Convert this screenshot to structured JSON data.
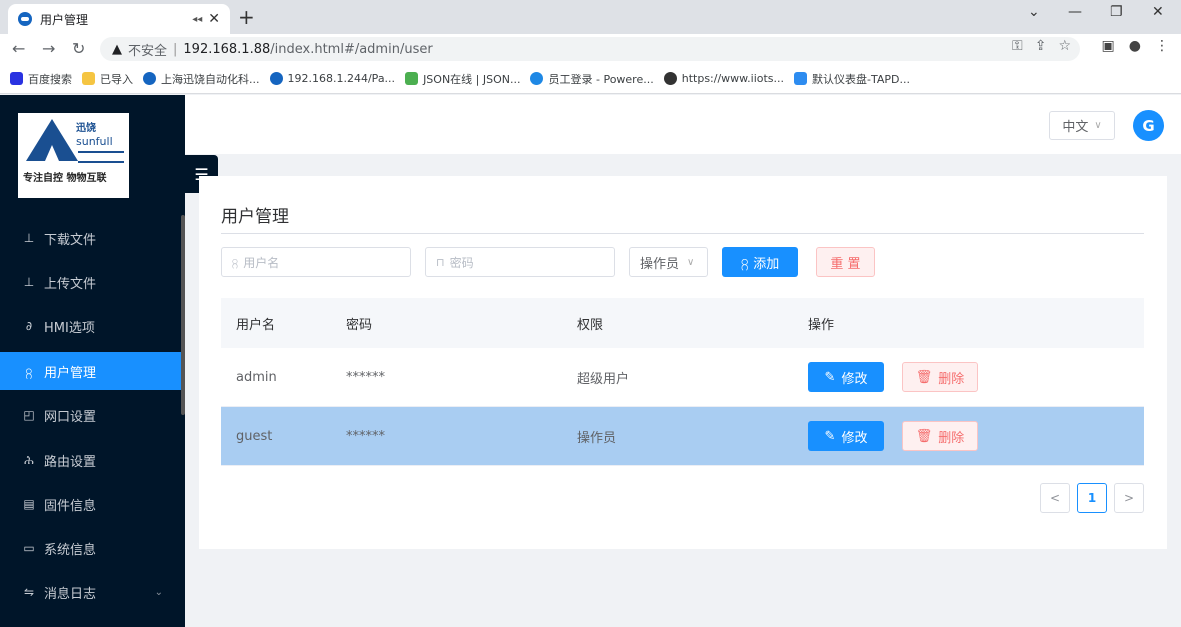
{
  "browser": {
    "tab_title": "用户管理",
    "url_warning": "▲",
    "url_insecure": "不安全",
    "url_sep": "|",
    "url_host": "192.168.1.88",
    "url_path": "/index.html#/admin/user",
    "bookmarks": [
      {
        "label": "百度搜索",
        "color": "#2932e1"
      },
      {
        "label": "已导入",
        "color": "#f5c542"
      },
      {
        "label": "上海迅饶自动化科...",
        "color": "#1565c0"
      },
      {
        "label": "192.168.1.244/Pa...",
        "color": "#1565c0"
      },
      {
        "label": "JSON在线 | JSON...",
        "color": "#4caf50"
      },
      {
        "label": "员工登录 - Powere...",
        "color": "#1e88e5"
      },
      {
        "label": "https://www.iiots...",
        "color": "#333333"
      },
      {
        "label": "默认仪表盘-TAPD...",
        "color": "#2d8cf0"
      }
    ]
  },
  "logo": {
    "brand_cn": "迅饶",
    "brand_en": "sunfull",
    "slogan": "专注自控 物物互联"
  },
  "sidebar": {
    "items": [
      {
        "label": "下载文件",
        "icon": "⊥"
      },
      {
        "label": "上传文件",
        "icon": "⊥"
      },
      {
        "label": "HMI选项",
        "icon": "∂"
      },
      {
        "label": "用户管理",
        "icon": "႙"
      },
      {
        "label": "网口设置",
        "icon": "◰"
      },
      {
        "label": "路由设置",
        "icon": "ሕ"
      },
      {
        "label": "固件信息",
        "icon": "▤"
      },
      {
        "label": "系统信息",
        "icon": "▭"
      },
      {
        "label": "消息日志",
        "icon": "⇋"
      }
    ]
  },
  "header": {
    "language": "中文",
    "avatar_letter": "G"
  },
  "page": {
    "title": "用户管理",
    "username_placeholder": "用户名",
    "password_placeholder": "密码",
    "role_select": "操作员",
    "add_label": "添加",
    "reset_label": "重 置"
  },
  "table": {
    "headers": [
      "用户名",
      "密码",
      "权限",
      "操作"
    ],
    "rows": [
      {
        "username": "admin",
        "password": "******",
        "role": "超级用户",
        "edit": "修改",
        "delete": "删除"
      },
      {
        "username": "guest",
        "password": "******",
        "role": "操作员",
        "edit": "修改",
        "delete": "删除"
      }
    ]
  },
  "pagination": {
    "current_page": "1",
    "prev": "<",
    "next": ">"
  }
}
